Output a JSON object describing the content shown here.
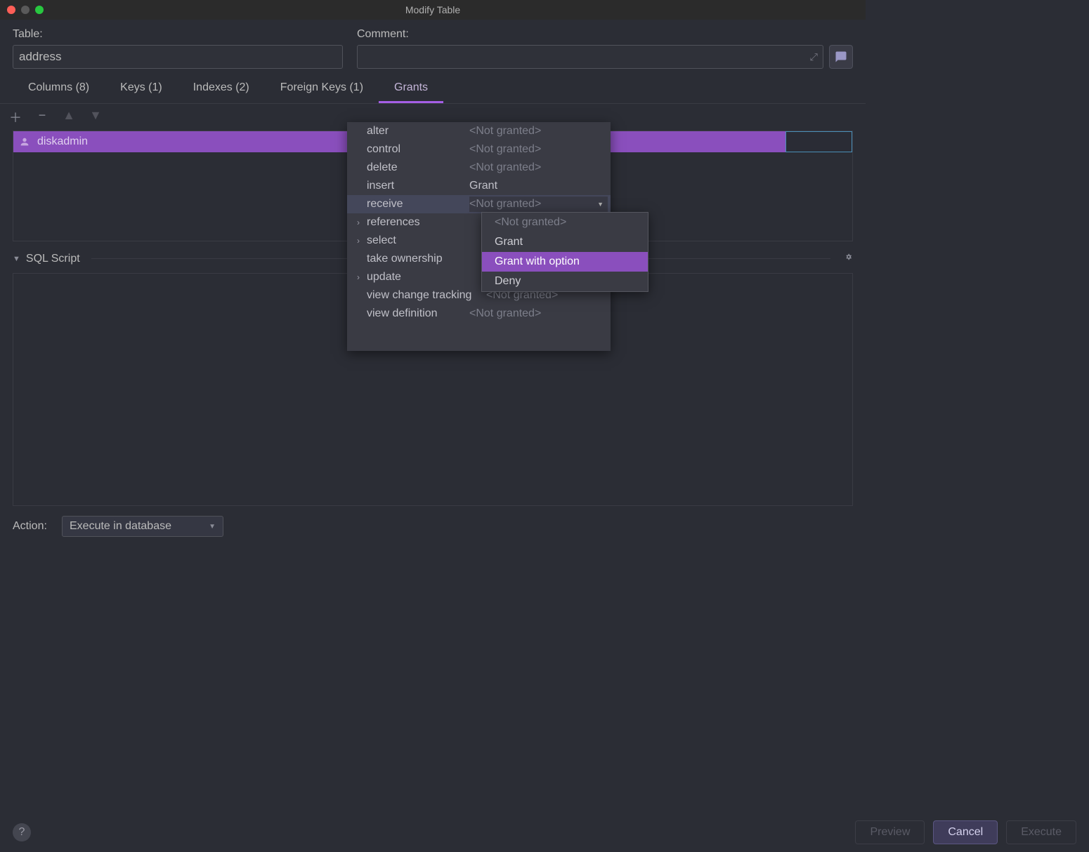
{
  "window": {
    "title": "Modify Table"
  },
  "form": {
    "table_label": "Table:",
    "table_value": "address",
    "comment_label": "Comment:",
    "comment_value": ""
  },
  "tabs": [
    {
      "label": "Columns (8)"
    },
    {
      "label": "Keys (1)"
    },
    {
      "label": "Indexes (2)"
    },
    {
      "label": "Foreign Keys (1)"
    },
    {
      "label": "Grants",
      "active": true
    }
  ],
  "grants": {
    "user": "diskadmin"
  },
  "permissions": [
    {
      "name": "alter",
      "status": "<Not granted>",
      "expandable": false
    },
    {
      "name": "control",
      "status": "<Not granted>",
      "expandable": false
    },
    {
      "name": "delete",
      "status": "<Not granted>",
      "expandable": false
    },
    {
      "name": "insert",
      "status": "Grant",
      "expandable": false,
      "granted": true
    },
    {
      "name": "receive",
      "status": "<Not granted>",
      "expandable": false,
      "selected": true
    },
    {
      "name": "references",
      "status": "",
      "expandable": true
    },
    {
      "name": "select",
      "status": "",
      "expandable": true
    },
    {
      "name": "take ownership",
      "status": "",
      "expandable": false
    },
    {
      "name": "update",
      "status": "",
      "expandable": true
    },
    {
      "name": "view change tracking",
      "status": "<Not granted>",
      "expandable": false
    },
    {
      "name": "view definition",
      "status": "<Not granted>",
      "expandable": false
    }
  ],
  "dropdown": {
    "items": [
      {
        "label": "<Not granted>",
        "muted": true
      },
      {
        "label": "Grant"
      },
      {
        "label": "Grant with option",
        "highlighted": true
      },
      {
        "label": "Deny"
      }
    ]
  },
  "sql": {
    "header": "SQL Script"
  },
  "action": {
    "label": "Action:",
    "value": "Execute in database"
  },
  "buttons": {
    "preview": "Preview",
    "cancel": "Cancel",
    "execute": "Execute"
  }
}
